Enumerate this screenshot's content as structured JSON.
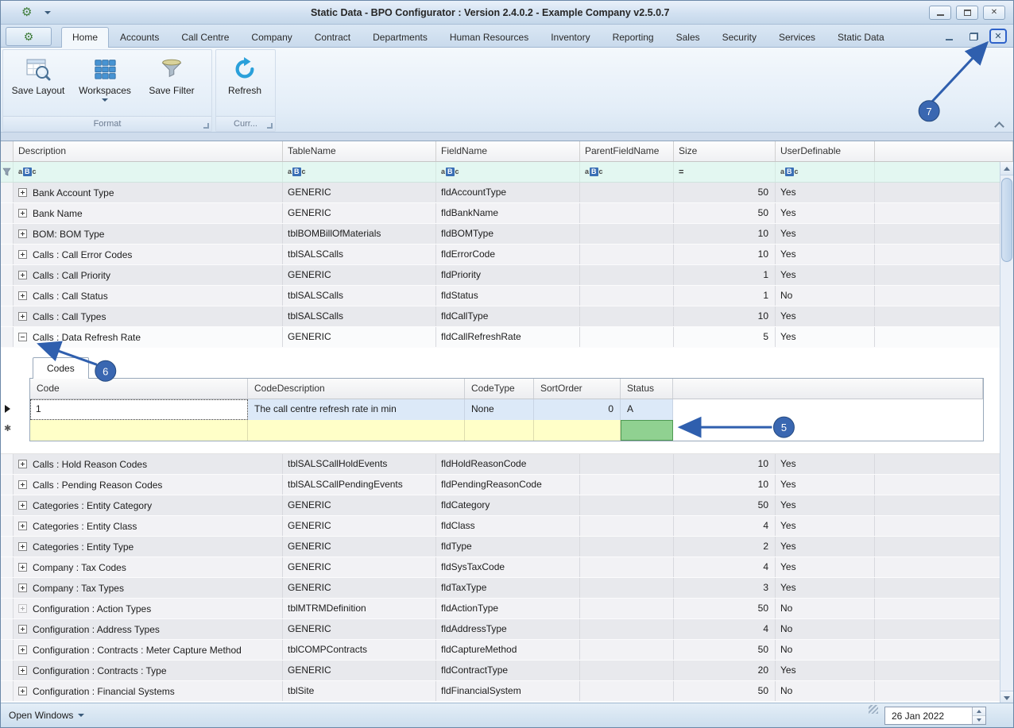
{
  "colors": {
    "annotation_blue": "#2f5fae",
    "annotation_fill": "#3a67b1",
    "filter_row_bg": "#e3f7f1",
    "new_row_bg": "#ffffc8",
    "status_cell_green": "#90d191",
    "selected_subrow_bg": "#dce9f8"
  },
  "icons": {
    "gear": "⚙",
    "close": "✕",
    "abc_filter": [
      "a",
      "B",
      "c"
    ],
    "new_row_asterisk": "✱"
  },
  "window": {
    "title": "Static Data - BPO Configurator : Version 2.4.0.2 - Example Company v2.5.0.7"
  },
  "ribbon": {
    "tabs": [
      {
        "label": "Home",
        "active": true
      },
      {
        "label": "Accounts"
      },
      {
        "label": "Call Centre"
      },
      {
        "label": "Company"
      },
      {
        "label": "Contract"
      },
      {
        "label": "Departments"
      },
      {
        "label": "Human Resources"
      },
      {
        "label": "Inventory"
      },
      {
        "label": "Reporting"
      },
      {
        "label": "Sales"
      },
      {
        "label": "Security"
      },
      {
        "label": "Services"
      },
      {
        "label": "Static Data"
      }
    ],
    "buttons": {
      "save_layout": "Save Layout",
      "workspaces": "Workspaces",
      "save_filter": "Save Filter",
      "refresh": "Refresh"
    },
    "groups": {
      "format": "Format",
      "current": "Curr..."
    }
  },
  "grid": {
    "columns": [
      "Description",
      "TableName",
      "FieldName",
      "ParentFieldName",
      "Size",
      "UserDefinable"
    ],
    "filter": {
      "size_operator": "="
    },
    "rows": [
      {
        "desc": "Bank Account Type",
        "table": "GENERIC",
        "field": "fldAccountType",
        "parent": "",
        "size": "50",
        "user": "Yes",
        "expand": "plus"
      },
      {
        "desc": "Bank Name",
        "table": "GENERIC",
        "field": "fldBankName",
        "parent": "",
        "size": "50",
        "user": "Yes",
        "expand": "plus"
      },
      {
        "desc": "BOM: BOM Type",
        "table": "tblBOMBillOfMaterials",
        "field": "fldBOMType",
        "parent": "",
        "size": "10",
        "user": "Yes",
        "expand": "plus"
      },
      {
        "desc": "Calls : Call Error Codes",
        "table": "tblSALSCalls",
        "field": "fldErrorCode",
        "parent": "",
        "size": "10",
        "user": "Yes",
        "expand": "plus"
      },
      {
        "desc": "Calls : Call Priority",
        "table": "GENERIC",
        "field": "fldPriority",
        "parent": "",
        "size": "1",
        "user": "Yes",
        "expand": "plus"
      },
      {
        "desc": "Calls : Call Status",
        "table": "tblSALSCalls",
        "field": "fldStatus",
        "parent": "",
        "size": "1",
        "user": "No",
        "expand": "plus"
      },
      {
        "desc": "Calls : Call Types",
        "table": "tblSALSCalls",
        "field": "fldCallType",
        "parent": "",
        "size": "10",
        "user": "Yes",
        "expand": "plus"
      },
      {
        "desc": "Calls : Data Refresh Rate",
        "table": "GENERIC",
        "field": "fldCallRefreshRate",
        "parent": "",
        "size": "5",
        "user": "Yes",
        "expand": "minus"
      },
      {
        "desc": "Calls : Hold Reason Codes",
        "table": "tblSALSCallHoldEvents",
        "field": "fldHoldReasonCode",
        "parent": "",
        "size": "10",
        "user": "Yes",
        "expand": "plus"
      },
      {
        "desc": "Calls : Pending Reason Codes",
        "table": "tblSALSCallPendingEvents",
        "field": "fldPendingReasonCode",
        "parent": "",
        "size": "10",
        "user": "Yes",
        "expand": "plus"
      },
      {
        "desc": "Categories : Entity Category",
        "table": "GENERIC",
        "field": "fldCategory",
        "parent": "",
        "size": "50",
        "user": "Yes",
        "expand": "plus"
      },
      {
        "desc": "Categories : Entity Class",
        "table": "GENERIC",
        "field": "fldClass",
        "parent": "",
        "size": "4",
        "user": "Yes",
        "expand": "plus"
      },
      {
        "desc": "Categories : Entity Type",
        "table": "GENERIC",
        "field": "fldType",
        "parent": "",
        "size": "2",
        "user": "Yes",
        "expand": "plus"
      },
      {
        "desc": "Company : Tax Codes",
        "table": "GENERIC",
        "field": "fldSysTaxCode",
        "parent": "",
        "size": "4",
        "user": "Yes",
        "expand": "plus"
      },
      {
        "desc": "Company : Tax Types",
        "table": "GENERIC",
        "field": "fldTaxType",
        "parent": "",
        "size": "3",
        "user": "Yes",
        "expand": "plus"
      },
      {
        "desc": "Configuration : Action Types",
        "table": "tblMTRMDefinition",
        "field": "fldActionType",
        "parent": "",
        "size": "50",
        "user": "No",
        "expand": "plus-dim"
      },
      {
        "desc": "Configuration : Address Types",
        "table": "GENERIC",
        "field": "fldAddressType",
        "parent": "",
        "size": "4",
        "user": "No",
        "expand": "plus"
      },
      {
        "desc": "Configuration : Contracts : Meter Capture Method",
        "table": "tblCOMPContracts",
        "field": "fldCaptureMethod",
        "parent": "",
        "size": "50",
        "user": "No",
        "expand": "plus"
      },
      {
        "desc": "Configuration : Contracts : Type",
        "table": "GENERIC",
        "field": "fldContractType",
        "parent": "",
        "size": "20",
        "user": "Yes",
        "expand": "plus"
      },
      {
        "desc": "Configuration : Financial Systems",
        "table": "tblSite",
        "field": "fldFinancialSystem",
        "parent": "",
        "size": "50",
        "user": "No",
        "expand": "plus"
      }
    ]
  },
  "detail": {
    "tab": "Codes",
    "columns": [
      "Code",
      "CodeDescription",
      "CodeType",
      "SortOrder",
      "Status"
    ],
    "rows": [
      {
        "code": "1",
        "description": "The call centre refresh rate in min",
        "type": "None",
        "sort": "0",
        "status": "A"
      }
    ]
  },
  "statusbar": {
    "open_windows": "Open Windows",
    "date": "26 Jan 2022"
  },
  "annotations": {
    "labels": [
      "5",
      "6",
      "7"
    ]
  }
}
